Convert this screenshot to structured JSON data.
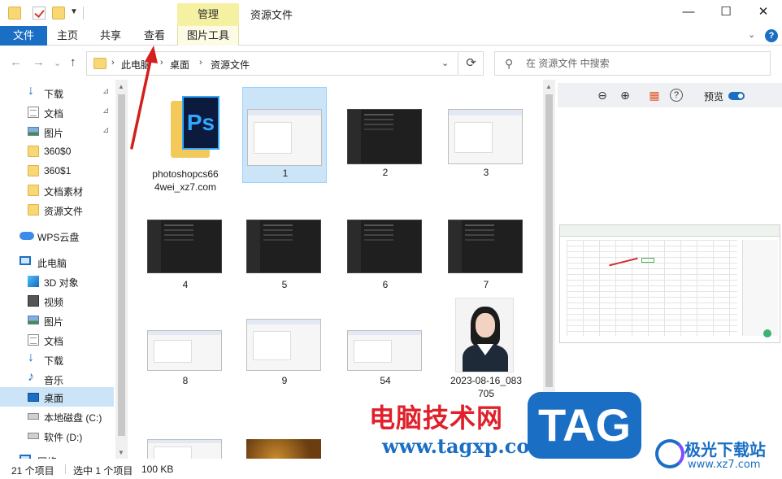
{
  "window": {
    "title": "资源文件",
    "context_tab_header": "管理",
    "minimize_glyph": "—",
    "maximize_glyph": "☐",
    "close_glyph": "✕"
  },
  "ribbon": {
    "tabs": [
      "文件",
      "主页",
      "共享",
      "查看",
      "图片工具"
    ],
    "chevron": "⌄",
    "help": "?"
  },
  "address": {
    "back": "←",
    "forward": "→",
    "history": "⌄",
    "up": "↑",
    "crumbs": [
      "此电脑",
      "桌面",
      "资源文件"
    ],
    "separator": "›",
    "dropdown": "⌄",
    "refresh": "⟳"
  },
  "search": {
    "placeholder": "在 资源文件 中搜索",
    "icon": "search-icon"
  },
  "sidebar": {
    "items": [
      {
        "label": "下载",
        "icon": "download-icon",
        "pinned": true
      },
      {
        "label": "文档",
        "icon": "document-icon",
        "pinned": true
      },
      {
        "label": "图片",
        "icon": "picture-icon",
        "pinned": true
      },
      {
        "label": "360$0",
        "icon": "folder-icon",
        "pinned": false
      },
      {
        "label": "360$1",
        "icon": "folder-icon",
        "pinned": false
      },
      {
        "label": "文档素材",
        "icon": "folder-icon",
        "pinned": false
      },
      {
        "label": "资源文件",
        "icon": "folder-icon",
        "pinned": false
      },
      {
        "label": "WPS云盘",
        "icon": "cloud-icon",
        "pinned": false
      },
      {
        "label": "此电脑",
        "icon": "computer-icon",
        "pinned": false
      },
      {
        "label": "3D 对象",
        "icon": "3d-objects-icon",
        "pinned": false
      },
      {
        "label": "视频",
        "icon": "video-icon",
        "pinned": false
      },
      {
        "label": "图片",
        "icon": "picture-icon",
        "pinned": false
      },
      {
        "label": "文档",
        "icon": "document-icon",
        "pinned": false
      },
      {
        "label": "下载",
        "icon": "download-icon",
        "pinned": false
      },
      {
        "label": "音乐",
        "icon": "music-icon",
        "pinned": false
      },
      {
        "label": "桌面",
        "icon": "desktop-icon",
        "pinned": false,
        "selected": true
      },
      {
        "label": "本地磁盘 (C:)",
        "icon": "drive-icon",
        "pinned": false
      },
      {
        "label": "软件 (D:)",
        "icon": "drive-icon",
        "pinned": false
      },
      {
        "label": "网络",
        "icon": "network-icon",
        "pinned": false
      }
    ],
    "pin_glyph": "📌"
  },
  "files": [
    {
      "name": "photoshopcs664wei_xz7.com",
      "line1": "photoshopcs66",
      "line2": "4wei_xz7.com",
      "kind": "folder-ps"
    },
    {
      "name": "1",
      "kind": "light",
      "selected": true
    },
    {
      "name": "2",
      "kind": "dark"
    },
    {
      "name": "3",
      "kind": "light"
    },
    {
      "name": "4",
      "kind": "dark"
    },
    {
      "name": "5",
      "kind": "dark"
    },
    {
      "name": "6",
      "kind": "dark"
    },
    {
      "name": "7",
      "kind": "dark"
    },
    {
      "name": "8",
      "kind": "light"
    },
    {
      "name": "9",
      "kind": "light"
    },
    {
      "name": "54",
      "kind": "light"
    },
    {
      "name": "2023-08-16_083705",
      "line1": "2023-08-16_083",
      "line2": "705",
      "kind": "photo"
    },
    {
      "name": "",
      "kind": "light"
    },
    {
      "name": "",
      "kind": "autumn"
    }
  ],
  "ps_icon_text": "Ps",
  "preview_pane": {
    "zoom_out": "⊖",
    "zoom_in": "⊕",
    "grid_glyph": "▦",
    "help_glyph": "?",
    "label": "预览",
    "toggle_on": true
  },
  "status": {
    "item_count": "21 个项目",
    "selection": "选中 1 个项目",
    "size": "100 KB"
  },
  "watermarks": {
    "site_cn": "电脑技术网",
    "site_url": "www.tagxp.com",
    "tag": "TAG",
    "logo_name": "极光下载站",
    "logo_url": "www.xz7.com"
  },
  "colors": {
    "accent": "#1a6fc4",
    "selection": "#cce4f7",
    "context_tab": "#f6f0a3",
    "annotation": "#d41f1f"
  }
}
